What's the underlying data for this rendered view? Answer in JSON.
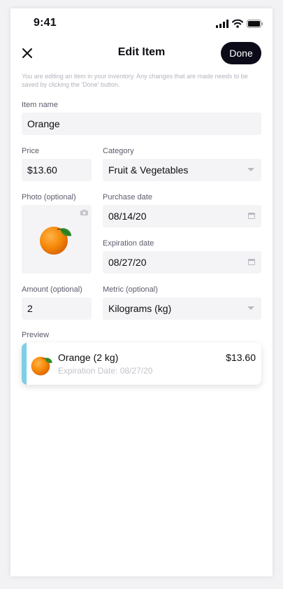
{
  "status": {
    "time": "9:41"
  },
  "nav": {
    "title": "Edit Item",
    "done_label": "Done"
  },
  "note": "You are editing an item in your inventory. Any changes that are made needs to be saved by clicking the 'Done' button.",
  "form": {
    "item_name": {
      "label": "Item name",
      "value": "Orange"
    },
    "price": {
      "label": "Price",
      "value": "$13.60"
    },
    "category": {
      "label": "Category",
      "value": "Fruit & Vegetables"
    },
    "photo": {
      "label": "Photo (optional)"
    },
    "purchase_date": {
      "label": "Purchase date",
      "value": "08/14/20"
    },
    "expiration_date": {
      "label": "Expiration date",
      "value": "08/27/20"
    },
    "amount": {
      "label": "Amount (optional)",
      "value": "2"
    },
    "metric": {
      "label": "Metric (optional)",
      "value": "Kilograms (kg)"
    }
  },
  "preview": {
    "label": "Preview",
    "name": "Orange (2 kg)",
    "price": "$13.60",
    "expiration": "Expiration Date: 08/27/20"
  },
  "colors": {
    "done_button": "#0b0b1a",
    "preview_accent": "#7ccfe6",
    "field_bg": "#f4f4f6"
  },
  "icons": [
    "signal-icon",
    "wifi-icon",
    "battery-icon",
    "close-icon",
    "camera-icon",
    "calendar-icon",
    "chevron-down-icon",
    "orange-image"
  ]
}
